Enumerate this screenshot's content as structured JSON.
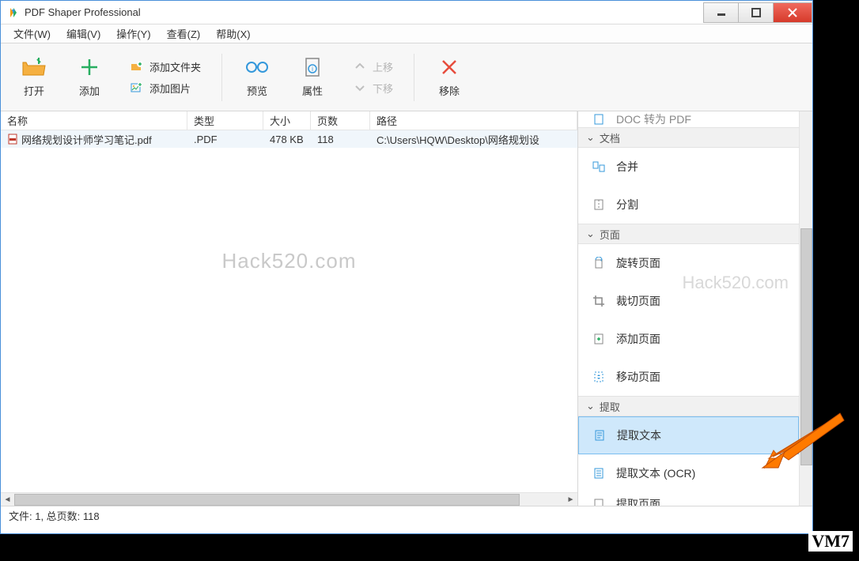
{
  "title": "PDF Shaper Professional",
  "menu": {
    "file": "文件(W)",
    "edit": "编辑(V)",
    "action": "操作(Y)",
    "view": "查看(Z)",
    "help": "帮助(X)"
  },
  "toolbar": {
    "open": "打开",
    "add": "添加",
    "add_folder": "添加文件夹",
    "add_image": "添加图片",
    "preview": "预览",
    "properties": "属性",
    "move_up": "上移",
    "move_down": "下移",
    "remove": "移除"
  },
  "columns": {
    "name": "名称",
    "type": "类型",
    "size": "大小",
    "pages": "页数",
    "path": "路径"
  },
  "file_row": {
    "name": "网络规划设计师学习笔记.pdf",
    "type": ".PDF",
    "size": "478 KB",
    "pages": "118",
    "path": "C:\\Users\\HQW\\Desktop\\网络规划设"
  },
  "watermark": "Hack520.com",
  "watermark2": "Hack520.com",
  "side": {
    "doc_to_pdf": "DOC 转为 PDF",
    "group_doc": "文档",
    "merge": "合并",
    "split": "分割",
    "group_page": "页面",
    "rotate": "旋转页面",
    "crop": "裁切页面",
    "add_page": "添加页面",
    "move_page": "移动页面",
    "group_extract": "提取",
    "extract_text": "提取文本",
    "extract_text_ocr": "提取文本 (OCR)",
    "extract_page": "提取页面"
  },
  "status": "文件: 1, 总页数: 118",
  "vm_label": "VM7"
}
